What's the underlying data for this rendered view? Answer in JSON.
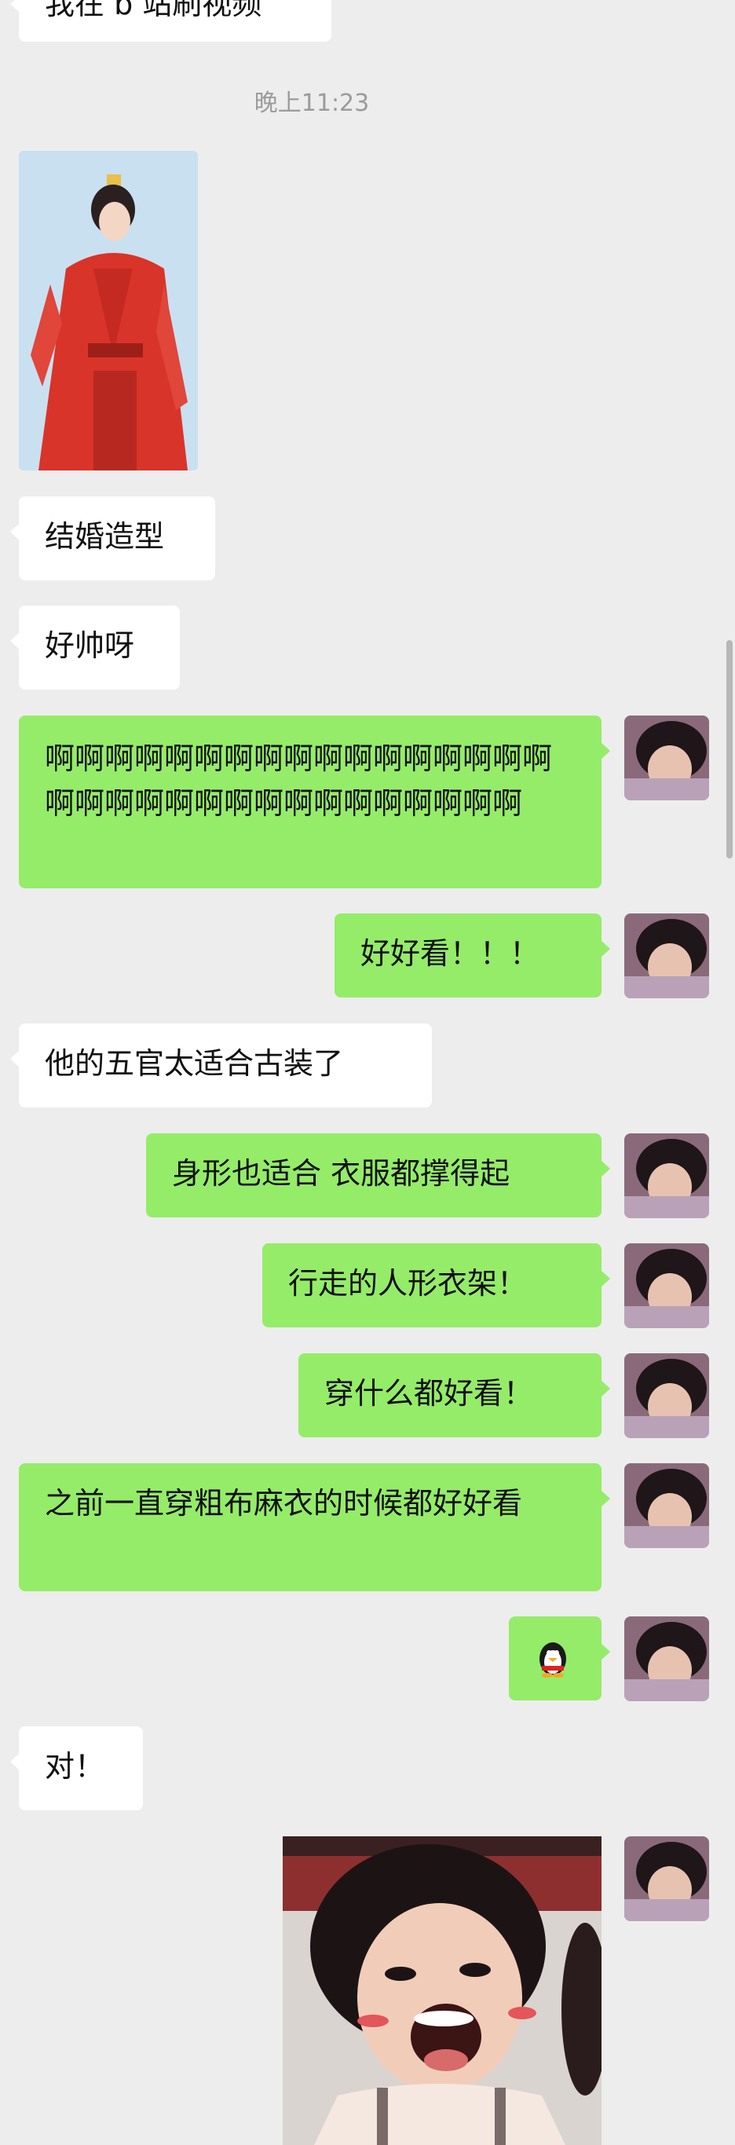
{
  "timestamp": "晚上11:23",
  "messages": [
    {
      "side": "in",
      "text": "我在 b 站刷视频"
    },
    {
      "side": "in",
      "type": "image",
      "description": "red-robed-costume-photo"
    },
    {
      "side": "in",
      "text": "结婚造型"
    },
    {
      "side": "in",
      "text": "好帅呀"
    },
    {
      "side": "out",
      "text": "啊啊啊啊啊啊啊啊啊啊啊啊啊啊啊啊啊啊啊啊啊啊啊啊啊啊啊啊啊啊啊啊啊"
    },
    {
      "side": "out",
      "text": "好好看！！！"
    },
    {
      "side": "in",
      "text": "他的五官太适合古装了"
    },
    {
      "side": "out",
      "text": "身形也适合 衣服都撑得起"
    },
    {
      "side": "out",
      "text": "行走的人形衣架！"
    },
    {
      "side": "out",
      "text": "穿什么都好看！"
    },
    {
      "side": "out",
      "text": "之前一直穿粗布麻衣的时候都好好看"
    },
    {
      "side": "out",
      "type": "emoji",
      "description": "penguin-emoji"
    },
    {
      "side": "in",
      "text": "对！"
    },
    {
      "side": "out",
      "type": "image",
      "description": "laughing-child-sticker"
    }
  ],
  "colors": {
    "background": "#ededed",
    "bubble_in": "#ffffff",
    "bubble_out": "#95ec69",
    "timestamp": "#9b9b9b"
  }
}
